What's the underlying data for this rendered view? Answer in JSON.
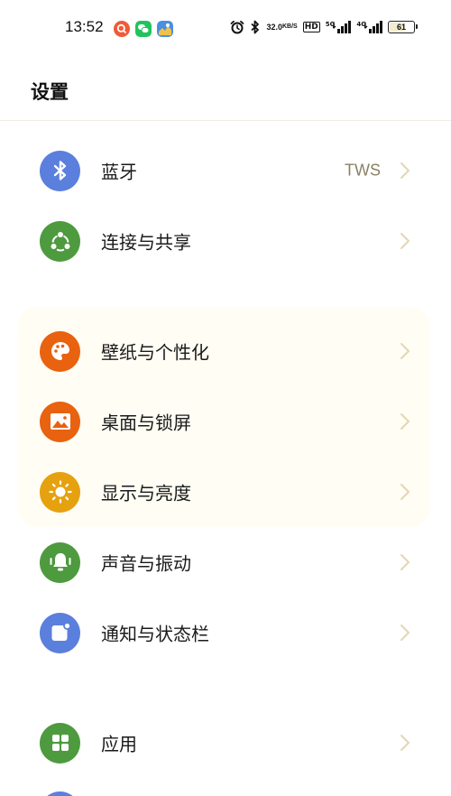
{
  "status_bar": {
    "time": "13:52",
    "net_speed_value": "32.0",
    "net_speed_unit": "KB/S",
    "hd_label": "HD",
    "signal1_label": "5G",
    "signal2_label": "4G",
    "battery_level": "61",
    "battery_fraction": 0.61
  },
  "header": {
    "title": "设置"
  },
  "colors": {
    "blue": "#5b7fdc",
    "green": "#4e9a3f",
    "orange": "#e8620f",
    "amber": "#e6a10f",
    "chevron": "#e3d6b3"
  },
  "settings": {
    "bluetooth": {
      "label": "蓝牙",
      "value": "TWS",
      "icon": "bluetooth-icon"
    },
    "connection": {
      "label": "连接与共享",
      "icon": "share-icon"
    },
    "wallpaper": {
      "label": "壁纸与个性化",
      "icon": "palette-icon"
    },
    "desktop": {
      "label": "桌面与锁屏",
      "icon": "picture-icon"
    },
    "display": {
      "label": "显示与亮度",
      "icon": "sun-icon"
    },
    "sound": {
      "label": "声音与振动",
      "icon": "bell-icon"
    },
    "notifications": {
      "label": "通知与状态栏",
      "icon": "notification-icon"
    },
    "apps": {
      "label": "应用",
      "icon": "apps-grid-icon"
    }
  }
}
